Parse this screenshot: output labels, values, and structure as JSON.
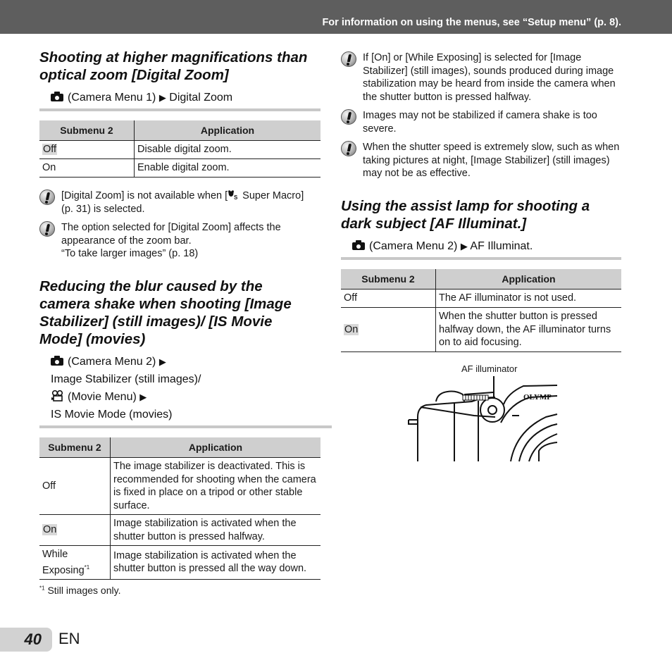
{
  "header": {
    "text": "For information on using the menus, see “Setup menu” (p. 8)."
  },
  "icons": {
    "camera": "camera-icon",
    "movie": "movie-camera-icon",
    "warning": "caution-icon",
    "arrow": "▶",
    "super_macro": "super-macro-icon"
  },
  "left": {
    "section1": {
      "title": "Shooting at higher magnifications than optical zoom [Digital Zoom]",
      "path_menu": "(Camera Menu 1)",
      "path_item": "Digital Zoom",
      "table": {
        "headers": [
          "Submenu 2",
          "Application"
        ],
        "rows": [
          {
            "submenu": "Off",
            "application": "Disable digital zoom.",
            "default": true
          },
          {
            "submenu": "On",
            "application": "Enable digital zoom.",
            "default": false
          }
        ]
      },
      "notes": [
        {
          "before": "[Digital Zoom] is not available when [",
          "after": " Super Macro] (p. 31) is selected."
        },
        {
          "line1": "The option selected for [Digital Zoom] affects the appearance of the zoom bar.",
          "line2": "“To take larger images” (p. 18)"
        }
      ]
    },
    "section2": {
      "title": "Reducing the blur caused by the camera shake when shooting [Image Stabilizer] (still images)/ [IS Movie Mode] (movies)",
      "path_line1_menu": "(Camera Menu 2)",
      "path_line2": "Image Stabilizer (still images)/",
      "path_line3_menu": "(Movie Menu)",
      "path_line4": "IS Movie Mode (movies)",
      "table": {
        "headers": [
          "Submenu 2",
          "Application"
        ],
        "rows": [
          {
            "submenu": "Off",
            "application": "The image stabilizer is deactivated. This is recommended for shooting when the camera is fixed in place on a tripod or other stable surface.",
            "default": false
          },
          {
            "submenu": "On",
            "application": "Image stabilization is activated when the shutter button is pressed halfway.",
            "default": true
          },
          {
            "submenu": "While Exposing",
            "submenu_sup": "*1",
            "application": "Image stabilization is activated when the shutter button is pressed all the way down.",
            "default": false
          }
        ]
      },
      "footnote_mark": "*1",
      "footnote": "Still images only."
    }
  },
  "right": {
    "notes": [
      "If [On] or [While Exposing] is selected for [Image Stabilizer] (still images), sounds produced during image stabilization may be heard from inside the camera when the shutter button is pressed halfway.",
      "Images may not be stabilized if camera shake is too severe.",
      "When the shutter speed is extremely slow, such as when taking pictures at night, [Image Stabilizer] (still images) may not be as effective."
    ],
    "section3": {
      "title": "Using the assist lamp for shooting a dark subject [AF Illuminat.]",
      "path_menu": "(Camera Menu 2)",
      "path_item": "AF Illuminat.",
      "table": {
        "headers": [
          "Submenu 2",
          "Application"
        ],
        "rows": [
          {
            "submenu": "Off",
            "application": "The AF illuminator is not used.",
            "default": false
          },
          {
            "submenu": "On",
            "application": "When the shutter button is pressed halfway down, the AF illuminator turns on to aid focusing.",
            "default": true
          }
        ]
      },
      "illustration": {
        "label": "AF illuminator",
        "brand_text": "OLYMP"
      }
    }
  },
  "footer": {
    "page_number": "40",
    "language": "EN"
  }
}
